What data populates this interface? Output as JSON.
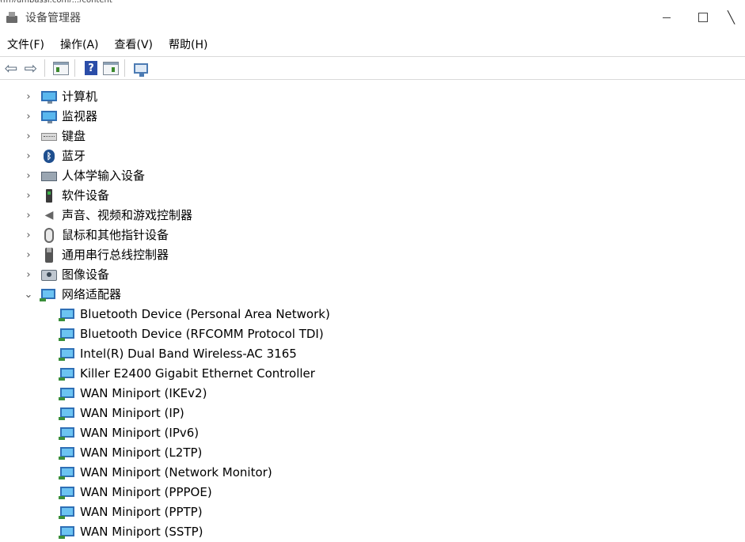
{
  "window": {
    "title": "设备管理器",
    "top_partial_text": "(m)/umbassi.com/.../content"
  },
  "menu": [
    "文件(F)",
    "操作(A)",
    "查看(V)",
    "帮助(H)"
  ],
  "toolbar": {
    "icons": [
      "back-arrow-icon",
      "forward-arrow-icon",
      "properties-icon",
      "help-icon",
      "update-driver-icon",
      "scan-hardware-icon"
    ]
  },
  "tree": {
    "categories": [
      {
        "label": "计算机",
        "expanded": false,
        "icon": "computer-icon"
      },
      {
        "label": "监视器",
        "expanded": false,
        "icon": "monitor-icon"
      },
      {
        "label": "键盘",
        "expanded": false,
        "icon": "keyboard-icon"
      },
      {
        "label": "蓝牙",
        "expanded": false,
        "icon": "bluetooth-icon"
      },
      {
        "label": "人体学输入设备",
        "expanded": false,
        "icon": "hid-icon"
      },
      {
        "label": "软件设备",
        "expanded": false,
        "icon": "software-device-icon"
      },
      {
        "label": "声音、视频和游戏控制器",
        "expanded": false,
        "icon": "speaker-icon"
      },
      {
        "label": "鼠标和其他指针设备",
        "expanded": false,
        "icon": "mouse-icon"
      },
      {
        "label": "通用串行总线控制器",
        "expanded": false,
        "icon": "usb-icon"
      },
      {
        "label": "图像设备",
        "expanded": false,
        "icon": "camera-icon"
      },
      {
        "label": "网络适配器",
        "expanded": true,
        "icon": "network-adapter-icon"
      }
    ],
    "network_adapters": [
      "Bluetooth Device (Personal Area Network)",
      "Bluetooth Device (RFCOMM Protocol TDI)",
      "Intel(R) Dual Band Wireless-AC 3165",
      "Killer E2400 Gigabit Ethernet Controller",
      "WAN Miniport (IKEv2)",
      "WAN Miniport (IP)",
      "WAN Miniport (IPv6)",
      "WAN Miniport (L2TP)",
      "WAN Miniport (Network Monitor)",
      "WAN Miniport (PPPOE)",
      "WAN Miniport (PPTP)",
      "WAN Miniport (SSTP)"
    ]
  },
  "chevrons": {
    "collapsed": "›",
    "expanded": "⌄"
  },
  "colors": {
    "accent": "#2f6fb5",
    "network_icon": "#6cc3f2"
  }
}
